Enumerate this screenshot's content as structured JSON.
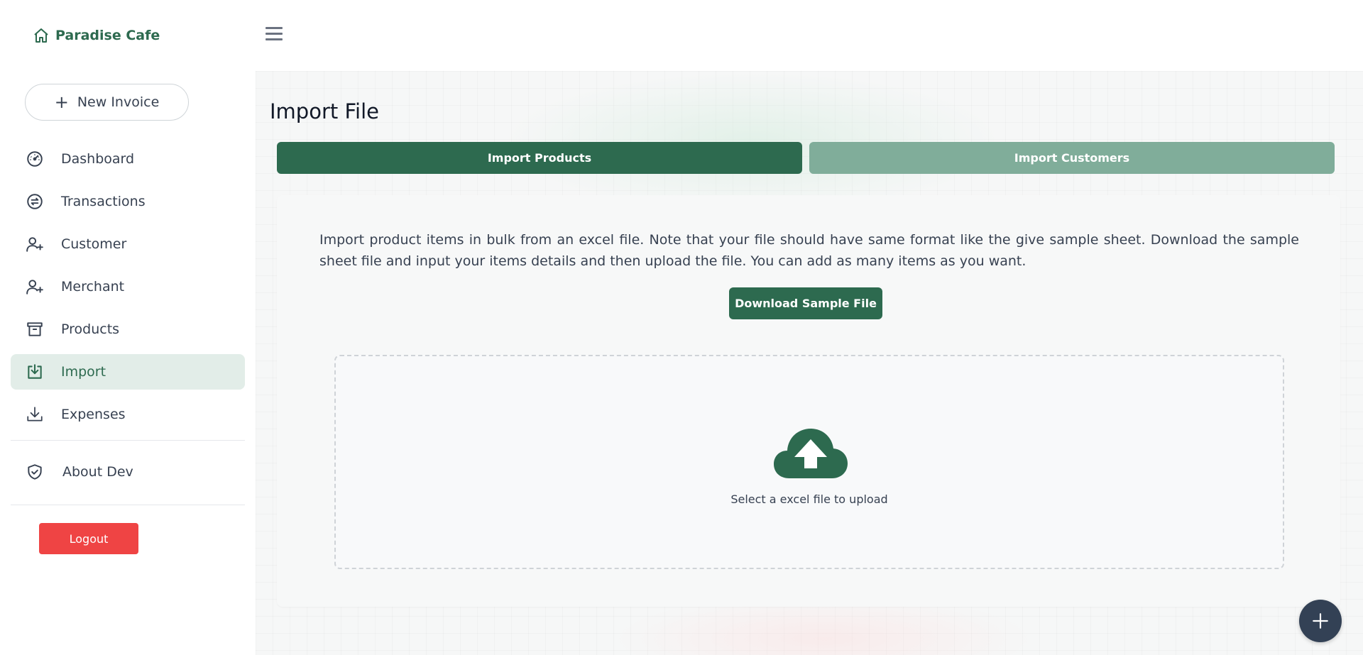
{
  "brand": {
    "name": "Paradise Cafe",
    "icon": "home-icon"
  },
  "sidebar": {
    "new_invoice": {
      "label": "New Invoice",
      "icon": "plus-icon"
    },
    "items": [
      {
        "label": "Dashboard",
        "icon": "speedometer-icon"
      },
      {
        "label": "Transactions",
        "icon": "exchange-icon"
      },
      {
        "label": "Customer",
        "icon": "user-plus-icon"
      },
      {
        "label": "Merchant",
        "icon": "user-plus-icon"
      },
      {
        "label": "Products",
        "icon": "archive-icon"
      },
      {
        "label": "Import",
        "icon": "import-icon",
        "active": true
      },
      {
        "label": "Expenses",
        "icon": "download-icon"
      }
    ],
    "about": {
      "label": "About Dev",
      "icon": "shield-check-icon"
    },
    "logout": {
      "label": "Logout"
    }
  },
  "topbar": {
    "menu_icon": "hamburger-icon"
  },
  "main": {
    "title": "Import File",
    "tabs": [
      {
        "label": "Import Products",
        "active": true
      },
      {
        "label": "Import Customers",
        "active": false
      }
    ],
    "description": "Import product items in bulk from an excel file. Note that your file should have same format like the give sample sheet. Download the sample sheet file and input your items details and then upload the file. You can add as many items as you want.",
    "download_button": "Download Sample File",
    "dropzone": {
      "text": "Select a excel file to upload",
      "icon": "cloud-upload-icon"
    }
  },
  "fab": {
    "icon": "plus-icon"
  },
  "colors": {
    "primary": "#2d6a4f",
    "primary_light": "#80ad9a",
    "active_bg": "#e2ede8",
    "danger": "#ef4444",
    "fab": "#334155"
  }
}
